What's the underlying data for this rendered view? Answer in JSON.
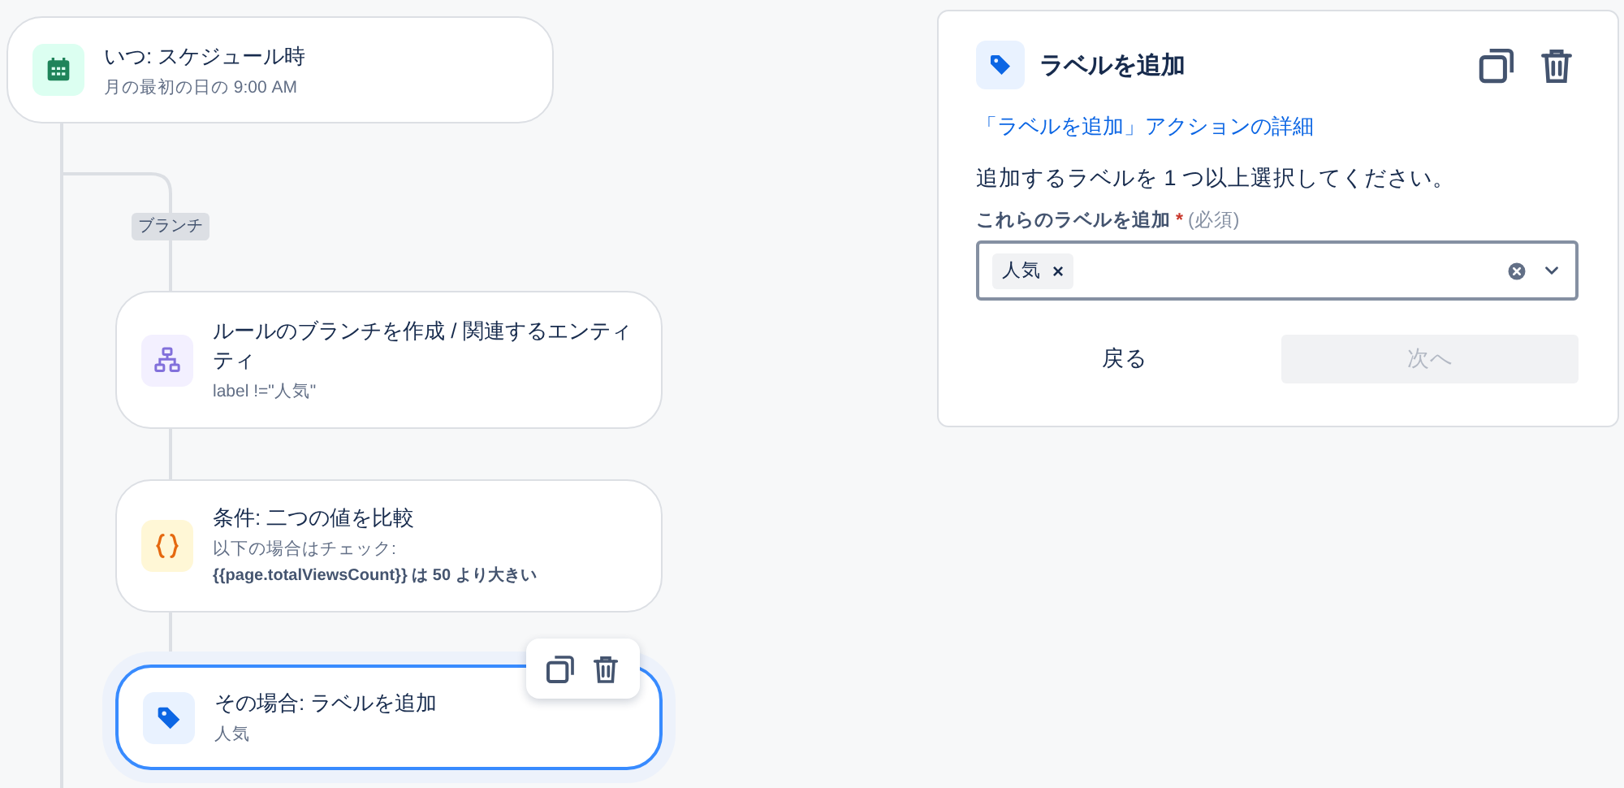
{
  "flow": {
    "branch_tag": "ブランチ",
    "nodes": [
      {
        "kind": "trigger",
        "selected": false,
        "title": "いつ: スケジュール時",
        "details": [
          {
            "text": "月の最初の日の 9:00 AM",
            "emphasis": false
          }
        ]
      },
      {
        "kind": "branch",
        "selected": false,
        "title": "ルールのブランチを作成 / 関連するエンティティ",
        "details": [
          {
            "text": "label !=\"人気\"",
            "emphasis": false
          }
        ]
      },
      {
        "kind": "condition",
        "selected": false,
        "title": "条件: 二つの値を比較",
        "details": [
          {
            "text": "以下の場合はチェック:",
            "emphasis": false
          },
          {
            "text": "{{page.totalViewsCount}} は 50 より大きい",
            "emphasis": true
          }
        ]
      },
      {
        "kind": "action",
        "selected": true,
        "title": "その場合: ラベルを追加",
        "details": [
          {
            "text": "人気",
            "emphasis": false
          }
        ]
      }
    ]
  },
  "panel": {
    "title": "ラベルを追加",
    "link": "「ラベルを追加」アクションの詳細",
    "instruction": "追加するラベルを 1 つ以上選択してください。",
    "field": {
      "label": "これらのラベルを追加",
      "required_mark": "*",
      "required_note": "(必須)",
      "tags": [
        {
          "label": "人気",
          "remove": "×"
        }
      ]
    },
    "buttons": [
      {
        "label": "戻る",
        "disabled": false
      },
      {
        "label": "次へ",
        "disabled": true
      }
    ]
  }
}
